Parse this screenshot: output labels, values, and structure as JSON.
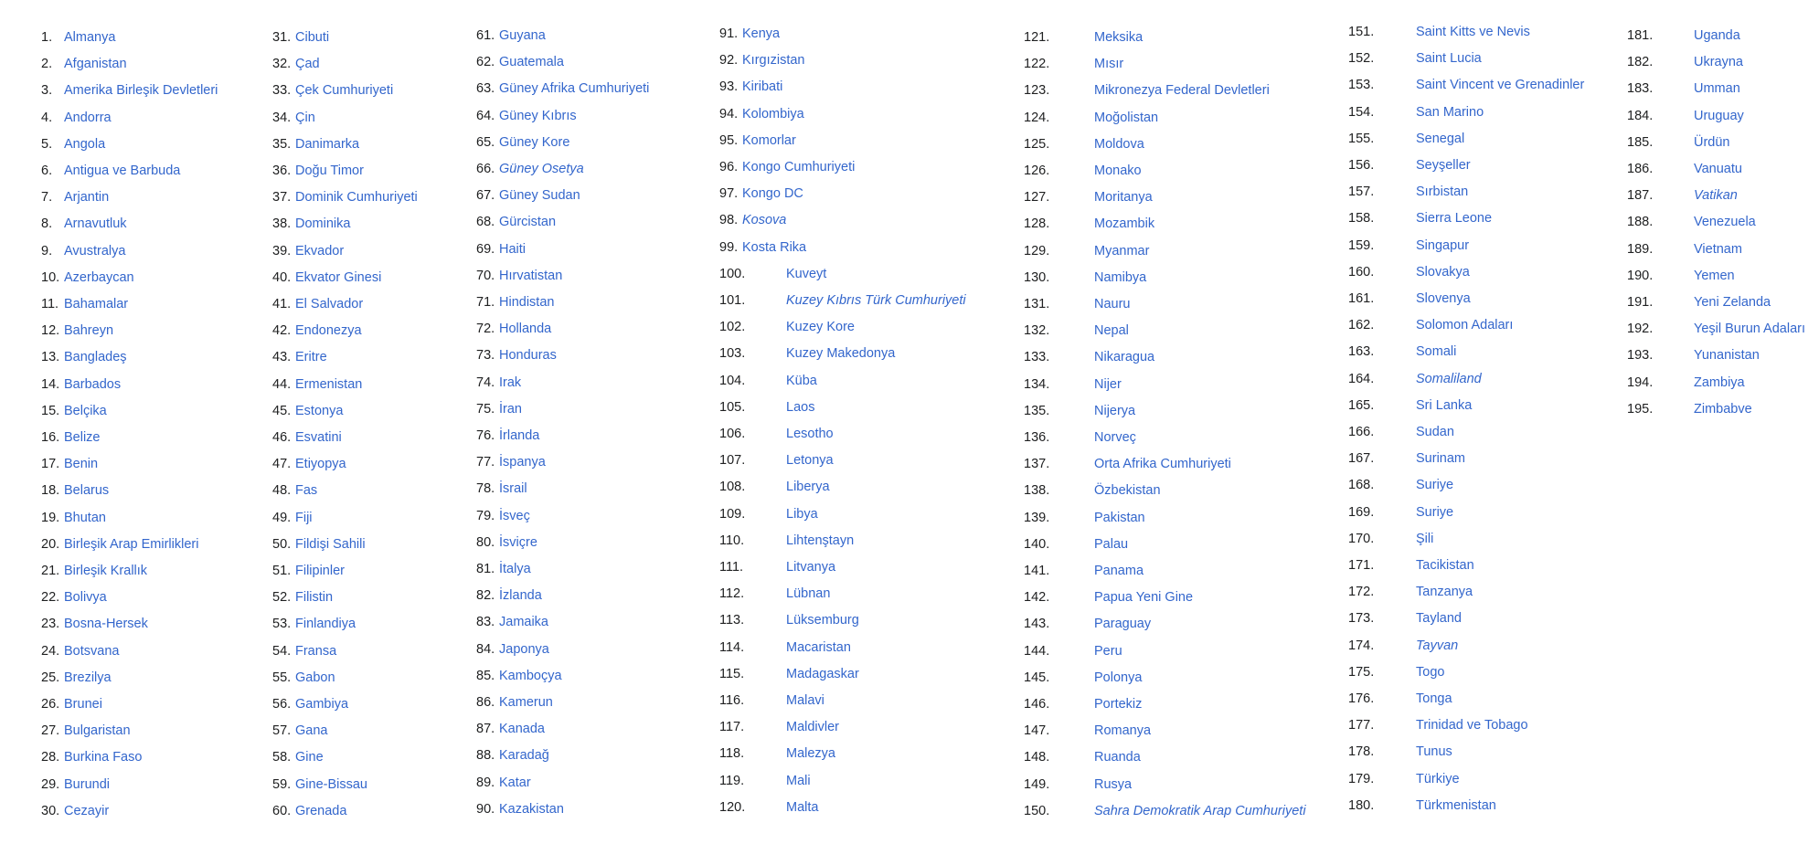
{
  "colors": {
    "link": "#3366cc",
    "number": "#202122",
    "background": "#ffffff"
  },
  "countries": [
    {
      "n": "1.",
      "name": "Almanya"
    },
    {
      "n": "2.",
      "name": "Afganistan"
    },
    {
      "n": "3.",
      "name": "Amerika Birleşik Devletleri"
    },
    {
      "n": "4.",
      "name": "Andorra"
    },
    {
      "n": "5.",
      "name": "Angola"
    },
    {
      "n": "6.",
      "name": "Antigua ve Barbuda"
    },
    {
      "n": "7.",
      "name": "Arjantin"
    },
    {
      "n": "8.",
      "name": "Arnavutluk"
    },
    {
      "n": "9.",
      "name": "Avustralya"
    },
    {
      "n": "10.",
      "name": "Azerbaycan"
    },
    {
      "n": "11.",
      "name": "Bahamalar"
    },
    {
      "n": "12.",
      "name": "Bahreyn"
    },
    {
      "n": "13.",
      "name": "Bangladeş"
    },
    {
      "n": "14.",
      "name": "Barbados"
    },
    {
      "n": "15.",
      "name": "Belçika"
    },
    {
      "n": "16.",
      "name": "Belize"
    },
    {
      "n": "17.",
      "name": "Benin"
    },
    {
      "n": "18.",
      "name": "Belarus"
    },
    {
      "n": "19.",
      "name": "Bhutan"
    },
    {
      "n": "20.",
      "name": "Birleşik Arap Emirlikleri"
    },
    {
      "n": "21.",
      "name": "Birleşik Krallık"
    },
    {
      "n": "22.",
      "name": "Bolivya"
    },
    {
      "n": "23.",
      "name": "Bosna-Hersek"
    },
    {
      "n": "24.",
      "name": "Botsvana"
    },
    {
      "n": "25.",
      "name": "Brezilya"
    },
    {
      "n": "26.",
      "name": "Brunei"
    },
    {
      "n": "27.",
      "name": "Bulgaristan"
    },
    {
      "n": "28.",
      "name": "Burkina Faso"
    },
    {
      "n": "29.",
      "name": "Burundi"
    },
    {
      "n": "30.",
      "name": "Cezayir"
    },
    {
      "n": "31.",
      "name": "Cibuti"
    },
    {
      "n": "32.",
      "name": "Çad"
    },
    {
      "n": "33.",
      "name": "Çek Cumhuriyeti"
    },
    {
      "n": "34.",
      "name": "Çin"
    },
    {
      "n": "35.",
      "name": "Danimarka"
    },
    {
      "n": "36.",
      "name": "Doğu Timor"
    },
    {
      "n": "37.",
      "name": "Dominik Cumhuriyeti"
    },
    {
      "n": "38.",
      "name": "Dominika"
    },
    {
      "n": "39.",
      "name": "Ekvador"
    },
    {
      "n": "40.",
      "name": "Ekvator Ginesi"
    },
    {
      "n": "41.",
      "name": "El Salvador"
    },
    {
      "n": "42.",
      "name": "Endonezya"
    },
    {
      "n": "43.",
      "name": "Eritre"
    },
    {
      "n": "44.",
      "name": "Ermenistan"
    },
    {
      "n": "45.",
      "name": "Estonya"
    },
    {
      "n": "46.",
      "name": "Esvatini"
    },
    {
      "n": "47.",
      "name": "Etiyopya"
    },
    {
      "n": "48.",
      "name": "Fas"
    },
    {
      "n": "49.",
      "name": "Fiji"
    },
    {
      "n": "50.",
      "name": "Fildişi Sahili"
    },
    {
      "n": "51.",
      "name": "Filipinler"
    },
    {
      "n": "52.",
      "name": "Filistin"
    },
    {
      "n": "53.",
      "name": "Finlandiya"
    },
    {
      "n": "54.",
      "name": "Fransa"
    },
    {
      "n": "55.",
      "name": "Gabon"
    },
    {
      "n": "56.",
      "name": "Gambiya"
    },
    {
      "n": "57.",
      "name": "Gana"
    },
    {
      "n": "58.",
      "name": "Gine"
    },
    {
      "n": "59.",
      "name": "Gine-Bissau"
    },
    {
      "n": "60.",
      "name": "Grenada"
    },
    {
      "n": "61.",
      "name": "Guyana"
    },
    {
      "n": "62.",
      "name": "Guatemala"
    },
    {
      "n": "63.",
      "name": "Güney Afrika Cumhuriyeti"
    },
    {
      "n": "64.",
      "name": "Güney Kıbrıs"
    },
    {
      "n": "65.",
      "name": "Güney Kore"
    },
    {
      "n": "66.",
      "name": "Güney Osetya",
      "italic": true
    },
    {
      "n": "67.",
      "name": "Güney Sudan"
    },
    {
      "n": "68.",
      "name": "Gürcistan"
    },
    {
      "n": "69.",
      "name": "Haiti"
    },
    {
      "n": "70.",
      "name": "Hırvatistan"
    },
    {
      "n": "71.",
      "name": "Hindistan"
    },
    {
      "n": "72.",
      "name": "Hollanda"
    },
    {
      "n": "73.",
      "name": "Honduras"
    },
    {
      "n": "74.",
      "name": "Irak"
    },
    {
      "n": "75.",
      "name": "İran"
    },
    {
      "n": "76.",
      "name": "İrlanda"
    },
    {
      "n": "77.",
      "name": "İspanya"
    },
    {
      "n": "78.",
      "name": "İsrail"
    },
    {
      "n": "79.",
      "name": "İsveç"
    },
    {
      "n": "80.",
      "name": "İsviçre"
    },
    {
      "n": "81.",
      "name": "İtalya"
    },
    {
      "n": "82.",
      "name": "İzlanda"
    },
    {
      "n": "83.",
      "name": "Jamaika"
    },
    {
      "n": "84.",
      "name": "Japonya"
    },
    {
      "n": "85.",
      "name": "Kamboçya"
    },
    {
      "n": "86.",
      "name": "Kamerun"
    },
    {
      "n": "87.",
      "name": "Kanada"
    },
    {
      "n": "88.",
      "name": "Karadağ"
    },
    {
      "n": "89.",
      "name": "Katar"
    },
    {
      "n": "90.",
      "name": "Kazakistan"
    },
    {
      "n": "91.",
      "name": "Kenya"
    },
    {
      "n": "92.",
      "name": "Kırgızistan"
    },
    {
      "n": "93.",
      "name": "Kiribati"
    },
    {
      "n": "94.",
      "name": "Kolombiya"
    },
    {
      "n": "95.",
      "name": "Komorlar"
    },
    {
      "n": "96.",
      "name": "Kongo Cumhuriyeti"
    },
    {
      "n": "97.",
      "name": "Kongo DC"
    },
    {
      "n": "98.",
      "name": "Kosova",
      "italic": true
    },
    {
      "n": "99.",
      "name": "Kosta Rika"
    },
    {
      "n": "100.",
      "name": "Kuveyt"
    },
    {
      "n": "101.",
      "name": "Kuzey Kıbrıs Türk Cumhuriyeti",
      "italic": true
    },
    {
      "n": "102.",
      "name": "Kuzey Kore"
    },
    {
      "n": "103.",
      "name": "Kuzey Makedonya"
    },
    {
      "n": "104.",
      "name": "Küba"
    },
    {
      "n": "105.",
      "name": "Laos"
    },
    {
      "n": "106.",
      "name": "Lesotho"
    },
    {
      "n": "107.",
      "name": "Letonya"
    },
    {
      "n": "108.",
      "name": "Liberya"
    },
    {
      "n": "109.",
      "name": "Libya"
    },
    {
      "n": "110.",
      "name": "Lihtenştayn"
    },
    {
      "n": "111.",
      "name": "Litvanya"
    },
    {
      "n": "112.",
      "name": "Lübnan"
    },
    {
      "n": "113.",
      "name": "Lüksemburg"
    },
    {
      "n": "114.",
      "name": "Macaristan"
    },
    {
      "n": "115.",
      "name": "Madagaskar"
    },
    {
      "n": "116.",
      "name": "Malavi"
    },
    {
      "n": "117.",
      "name": "Maldivler"
    },
    {
      "n": "118.",
      "name": "Malezya"
    },
    {
      "n": "119.",
      "name": "Mali"
    },
    {
      "n": "120.",
      "name": "Malta"
    },
    {
      "n": "121.",
      "name": "Meksika"
    },
    {
      "n": "122.",
      "name": "Mısır"
    },
    {
      "n": "123.",
      "name": "Mikronezya Federal Devletleri"
    },
    {
      "n": "124.",
      "name": "Moğolistan"
    },
    {
      "n": "125.",
      "name": "Moldova"
    },
    {
      "n": "126.",
      "name": "Monako"
    },
    {
      "n": "127.",
      "name": "Moritanya"
    },
    {
      "n": "128.",
      "name": "Mozambik"
    },
    {
      "n": "129.",
      "name": "Myanmar"
    },
    {
      "n": "130.",
      "name": "Namibya"
    },
    {
      "n": "131.",
      "name": "Nauru"
    },
    {
      "n": "132.",
      "name": "Nepal"
    },
    {
      "n": "133.",
      "name": "Nikaragua"
    },
    {
      "n": "134.",
      "name": "Nijer"
    },
    {
      "n": "135.",
      "name": "Nijerya"
    },
    {
      "n": "136.",
      "name": "Norveç"
    },
    {
      "n": "137.",
      "name": "Orta Afrika Cumhuriyeti"
    },
    {
      "n": "138.",
      "name": "Özbekistan"
    },
    {
      "n": "139.",
      "name": "Pakistan"
    },
    {
      "n": "140.",
      "name": "Palau"
    },
    {
      "n": "141.",
      "name": "Panama"
    },
    {
      "n": "142.",
      "name": "Papua Yeni Gine"
    },
    {
      "n": "143.",
      "name": "Paraguay"
    },
    {
      "n": "144.",
      "name": "Peru"
    },
    {
      "n": "145.",
      "name": "Polonya"
    },
    {
      "n": "146.",
      "name": "Portekiz"
    },
    {
      "n": "147.",
      "name": "Romanya"
    },
    {
      "n": "148.",
      "name": "Ruanda"
    },
    {
      "n": "149.",
      "name": "Rusya"
    },
    {
      "n": "150.",
      "name": "Sahra Demokratik Arap Cumhuriyeti",
      "italic": true
    },
    {
      "n": "151.",
      "name": "Saint Kitts ve Nevis"
    },
    {
      "n": "152.",
      "name": "Saint Lucia"
    },
    {
      "n": "153.",
      "name": "Saint Vincent ve Grenadinler"
    },
    {
      "n": "154.",
      "name": "San Marino"
    },
    {
      "n": "155.",
      "name": "Senegal"
    },
    {
      "n": "156.",
      "name": "Seyşeller"
    },
    {
      "n": "157.",
      "name": "Sırbistan"
    },
    {
      "n": "158.",
      "name": "Sierra Leone"
    },
    {
      "n": "159.",
      "name": "Singapur"
    },
    {
      "n": "160.",
      "name": "Slovakya"
    },
    {
      "n": "161.",
      "name": "Slovenya"
    },
    {
      "n": "162.",
      "name": "Solomon Adaları"
    },
    {
      "n": "163.",
      "name": "Somali"
    },
    {
      "n": "164.",
      "name": "Somaliland",
      "italic": true
    },
    {
      "n": "165.",
      "name": "Sri Lanka"
    },
    {
      "n": "166.",
      "name": "Sudan"
    },
    {
      "n": "167.",
      "name": "Surinam"
    },
    {
      "n": "168.",
      "name": "Suriye"
    },
    {
      "n": "169.",
      "name": "Suriye"
    },
    {
      "n": "170.",
      "name": "Şili"
    },
    {
      "n": "171.",
      "name": "Tacikistan"
    },
    {
      "n": "172.",
      "name": "Tanzanya"
    },
    {
      "n": "173.",
      "name": "Tayland"
    },
    {
      "n": "174.",
      "name": "Tayvan",
      "italic": true
    },
    {
      "n": "175.",
      "name": "Togo"
    },
    {
      "n": "176.",
      "name": "Tonga"
    },
    {
      "n": "177.",
      "name": "Trinidad ve Tobago"
    },
    {
      "n": "178.",
      "name": "Tunus"
    },
    {
      "n": "179.",
      "name": "Türkiye"
    },
    {
      "n": "180.",
      "name": "Türkmenistan"
    },
    {
      "n": "181.",
      "name": "Uganda"
    },
    {
      "n": "182.",
      "name": "Ukrayna"
    },
    {
      "n": "183.",
      "name": "Umman"
    },
    {
      "n": "184.",
      "name": "Uruguay"
    },
    {
      "n": "185.",
      "name": "Ürdün"
    },
    {
      "n": "186.",
      "name": "Vanuatu"
    },
    {
      "n": "187.",
      "name": "Vatikan",
      "italic": true
    },
    {
      "n": "188.",
      "name": "Venezuela"
    },
    {
      "n": "189.",
      "name": "Vietnam"
    },
    {
      "n": "190.",
      "name": "Yemen"
    },
    {
      "n": "191.",
      "name": "Yeni Zelanda"
    },
    {
      "n": "192.",
      "name": "Yeşil Burun Adaları"
    },
    {
      "n": "193.",
      "name": "Yunanistan"
    },
    {
      "n": "194.",
      "name": "Zambiya"
    },
    {
      "n": "195.",
      "name": "Zimbabve"
    }
  ]
}
